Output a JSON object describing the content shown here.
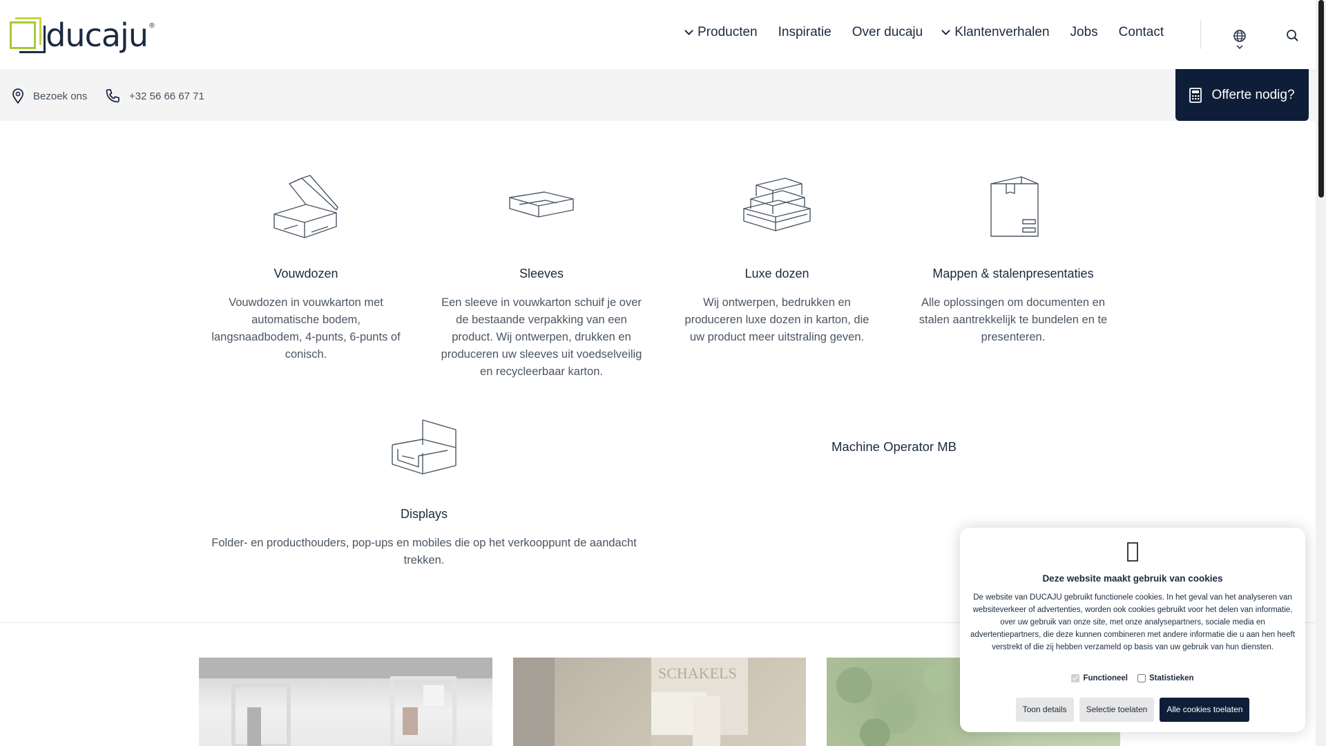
{
  "header": {
    "logo_text": "ducaju",
    "logo_reg": "®",
    "nav": [
      {
        "label": "Producten",
        "has_dropdown": true
      },
      {
        "label": "Inspiratie",
        "has_dropdown": false
      },
      {
        "label": "Over ducaju",
        "has_dropdown": false
      },
      {
        "label": "Klantenverhalen",
        "has_dropdown": true
      },
      {
        "label": "Jobs",
        "has_dropdown": false
      },
      {
        "label": "Contact",
        "has_dropdown": false
      }
    ],
    "icons": [
      "globe-icon",
      "search-icon"
    ]
  },
  "subbar": {
    "visit_label": "Bezoek ons",
    "phone_label": "+32 56 66 67 71",
    "quote_label": "Offerte nodig?"
  },
  "products": [
    {
      "title": "Vouwdozen",
      "desc": "Vouwdozen in vouwkarton met automatische bodem, langsnaadbodem, 4-punts, 6-punts of conisch."
    },
    {
      "title": "Sleeves",
      "desc": "Een sleeve in vouwkarton schuif je over de bestaande verpakking van een product. Wij ontwerpen, drukken en produceren uw sleeves uit voedselveilig en recycleerbaar karton."
    },
    {
      "title": "Luxe dozen",
      "desc": "Wij ontwerpen, bedrukken en produceren luxe dozen in karton, die uw product meer uitstraling geven."
    },
    {
      "title": "Mappen & stalenpresentaties",
      "desc": "Alle oplossingen om documenten en stalen aantrekkelijk te bundelen en te presenteren."
    },
    {
      "title": "Displays",
      "desc": "Folder- en producthouders, pop-ups en mobiles die op het verkooppunt de aandacht trekken."
    }
  ],
  "machine_label": "Machine Operator MB",
  "cookie": {
    "title": "Deze website maakt gebruik van cookies",
    "text": "De website van DUCAJU gebruikt functionele cookies. In het geval van het analyseren van websiteverkeer of advertenties, worden ook cookies gebruikt voor het delen van informatie, over uw gebruik van onze site, met onze analysepartners, sociale media en advertentiepartners, die deze kunnen combineren met andere informatie die u aan hen heeft verstrekt of die zij hebben verzameld op basis van uw gebruik van hun diensten.",
    "check_functional": "Functioneel",
    "check_stats": "Statistieken",
    "btn_details": "Toon details",
    "btn_selection": "Selectie toelaten",
    "btn_all": "Alle cookies toelaten"
  },
  "colors": {
    "navy": "#0f1e38",
    "text": "#1b2a3f",
    "logo_green": "#a6c936",
    "subbar_bg": "#f4f4f4"
  }
}
